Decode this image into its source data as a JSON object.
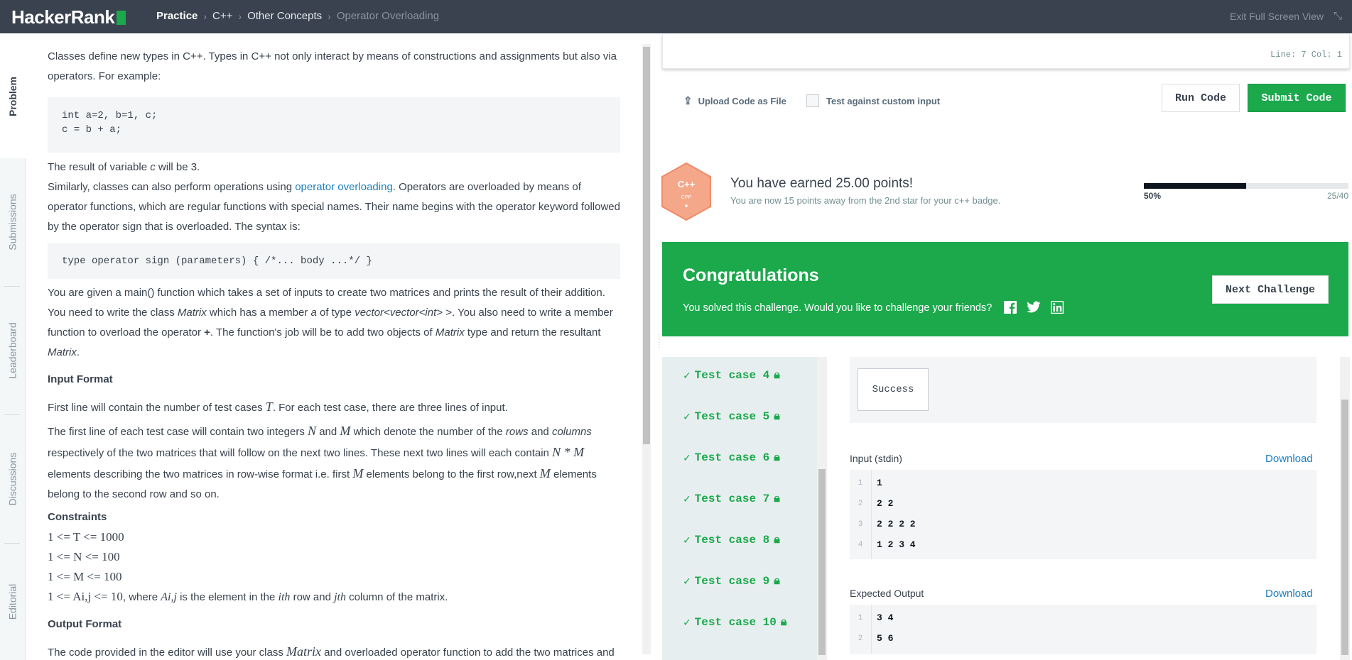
{
  "topbar": {
    "logo": "HackerRank",
    "breadcrumbs": [
      "Practice",
      "C++",
      "Other Concepts",
      "Operator Overloading"
    ],
    "exit_fullscreen": "Exit Full Screen View"
  },
  "sidetabs": [
    "Problem",
    "Submissions",
    "Leaderboard",
    "Discussions",
    "Editorial"
  ],
  "problem": {
    "intro": "Classes define new types in C++. Types in C++ not only interact by means of constructions and assignments but also via operators. For example:",
    "code1": "int a=2, b=1, c;\nc = b + a;",
    "result_pre": "The result of variable ",
    "result_var": "c",
    "result_post": " will be 3.",
    "similarly_pre": "Similarly, classes can also perform operations using ",
    "similarly_link": "operator overloading",
    "similarly_post": ". Operators are overloaded by means of operator functions, which are regular functions with special names. Their name begins with the operator keyword followed by the operator sign that is overloaded. The syntax is:",
    "code2": "type operator sign (parameters) { /*... body ...*/ }",
    "task_1": "You are given a main() function which takes a set of inputs to create two matrices and prints the result of their addition. You need to write the class ",
    "task_matrix": "Matrix",
    "task_2": " which has a member ",
    "task_a": "a",
    "task_3": " of type ",
    "task_type": "vector<vector<int> >",
    "task_4": ". You also need to write a member function to overload the operator ",
    "task_plus": "+",
    "task_5": ". The function's job will be to add two objects of ",
    "task_6": " type and return the resultant ",
    "task_7": ".",
    "input_format_title": "Input Format",
    "if1_pre": "First line will contain the number of test cases ",
    "if1_T": "T",
    "if1_post": ". For each test case, there are three lines of input.",
    "if2_a": "The first line of each test case will contain two integers ",
    "if2_N": "N",
    "if2_and": " and ",
    "if2_M": "M",
    "if2_b": " which denote the number of the ",
    "if2_rows": "rows",
    "if2_c": " and ",
    "if2_cols": "columns",
    "if2_d": " respectively of the two matrices that will follow on the next two lines. These next two lines will each contain ",
    "if2_NM": "N * M",
    "if2_e": " elements describing the two matrices in row-wise format i.e. first ",
    "if2_f": " elements belong to the first row,next ",
    "if2_g": " elements belong to the second row and so on.",
    "constraints_title": "Constraints",
    "constraints": [
      "1 <= T <= 1000",
      "1 <= N <= 100",
      "1 <= M <= 100",
      "1 <= Ai,j <= 10"
    ],
    "c4_where": ", where ",
    "c4_A": "Ai,j",
    "c4_is": " is the element in the ",
    "c4_ith": "ith",
    "c4_row": " row and ",
    "c4_jth": "jth",
    "c4_col": " column of the matrix.",
    "output_format_title": "Output Format",
    "of1_pre": "The code provided in the editor will use your class ",
    "of1_post": " and overloaded operator function to add the two matrices and"
  },
  "editor": {
    "status": "Line: 7 Col: 1",
    "upload": "Upload Code as File",
    "custom_input": "Test against custom input",
    "run": "Run Code",
    "submit": "Submit Code"
  },
  "badge": {
    "lang": "C++",
    "sub": "CPP",
    "earned": "You have earned 25.00 points!",
    "sub_text": "You are now 15 points away from the 2nd star for your c++ badge.",
    "progress_pct": "50%",
    "progress_count": "25/40",
    "progress_value": 0.5
  },
  "congrats": {
    "title": "Congratulations",
    "message": "You solved this challenge. Would you like to challenge your friends?",
    "next": "Next Challenge"
  },
  "testcases": [
    "Test case 4",
    "Test case 5",
    "Test case 6",
    "Test case 7",
    "Test case 8",
    "Test case 9",
    "Test case 10"
  ],
  "result": {
    "status": "Success",
    "input_label": "Input (stdin)",
    "download": "Download",
    "input_lines": [
      [
        "1",
        "1"
      ],
      [
        "2",
        "2 2"
      ],
      [
        "3",
        "2 2 2 2"
      ],
      [
        "4",
        "1 2 3 4"
      ]
    ],
    "expected_label": "Expected Output",
    "expected_lines": [
      [
        "1",
        "3 4"
      ],
      [
        "2",
        "5 6"
      ]
    ]
  },
  "colors": {
    "brand_green": "#1ba94c",
    "topbar": "#39424e",
    "link": "#1a7fc1"
  }
}
